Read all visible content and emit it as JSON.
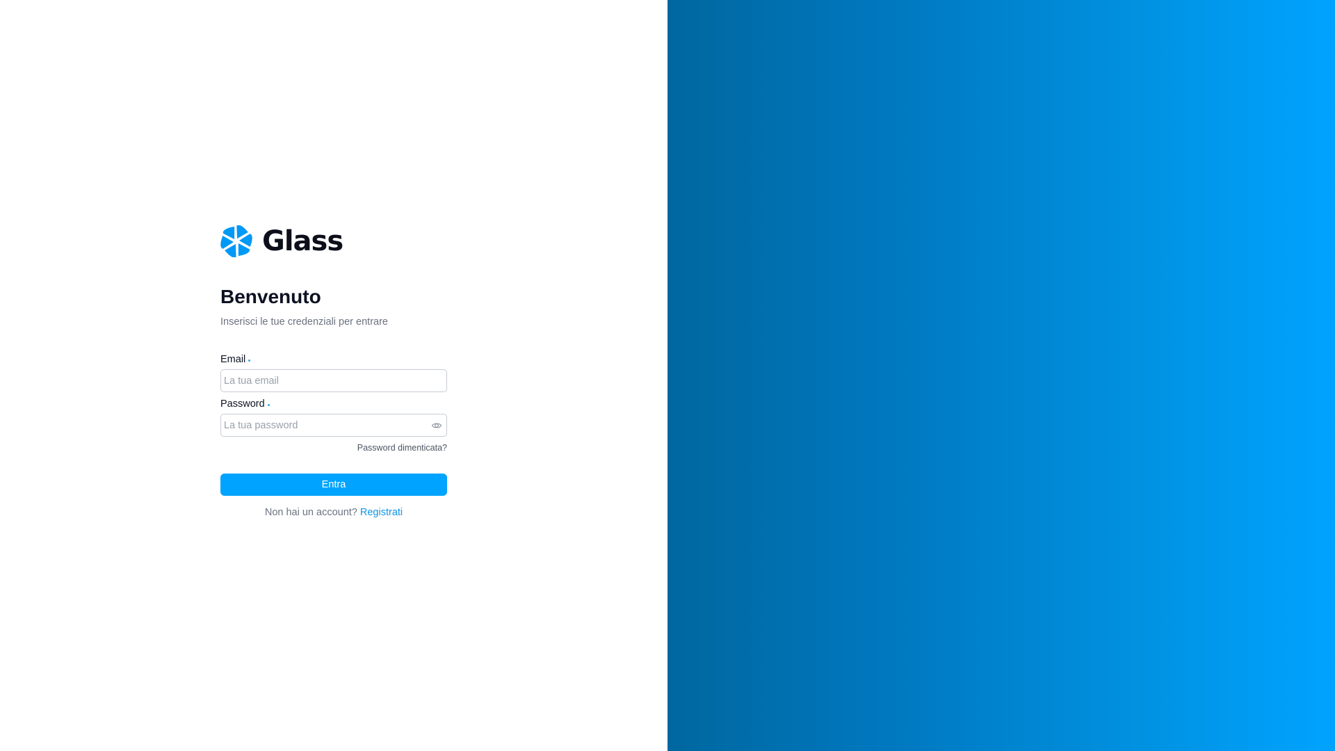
{
  "brand": {
    "name": "Glass",
    "logo_icon": "flower-petal-logo-icon",
    "accent_color": "#00a3ff"
  },
  "login": {
    "title": "Benvenuto",
    "subtitle": "Inserisci le tue credenziali per entrare",
    "email": {
      "label": "Email",
      "placeholder": "La tua email",
      "value": ""
    },
    "password": {
      "label": "Password",
      "placeholder": "La tua password",
      "value": "",
      "toggle_icon": "eye-icon"
    },
    "forgot_password": "Password dimenticata?",
    "submit_label": "Entra",
    "signup_prompt": "Non hai un account?",
    "signup_link": "Registrati"
  },
  "side_panel": {
    "gradient_start": "#00679f",
    "gradient_end": "#00a3ff"
  }
}
